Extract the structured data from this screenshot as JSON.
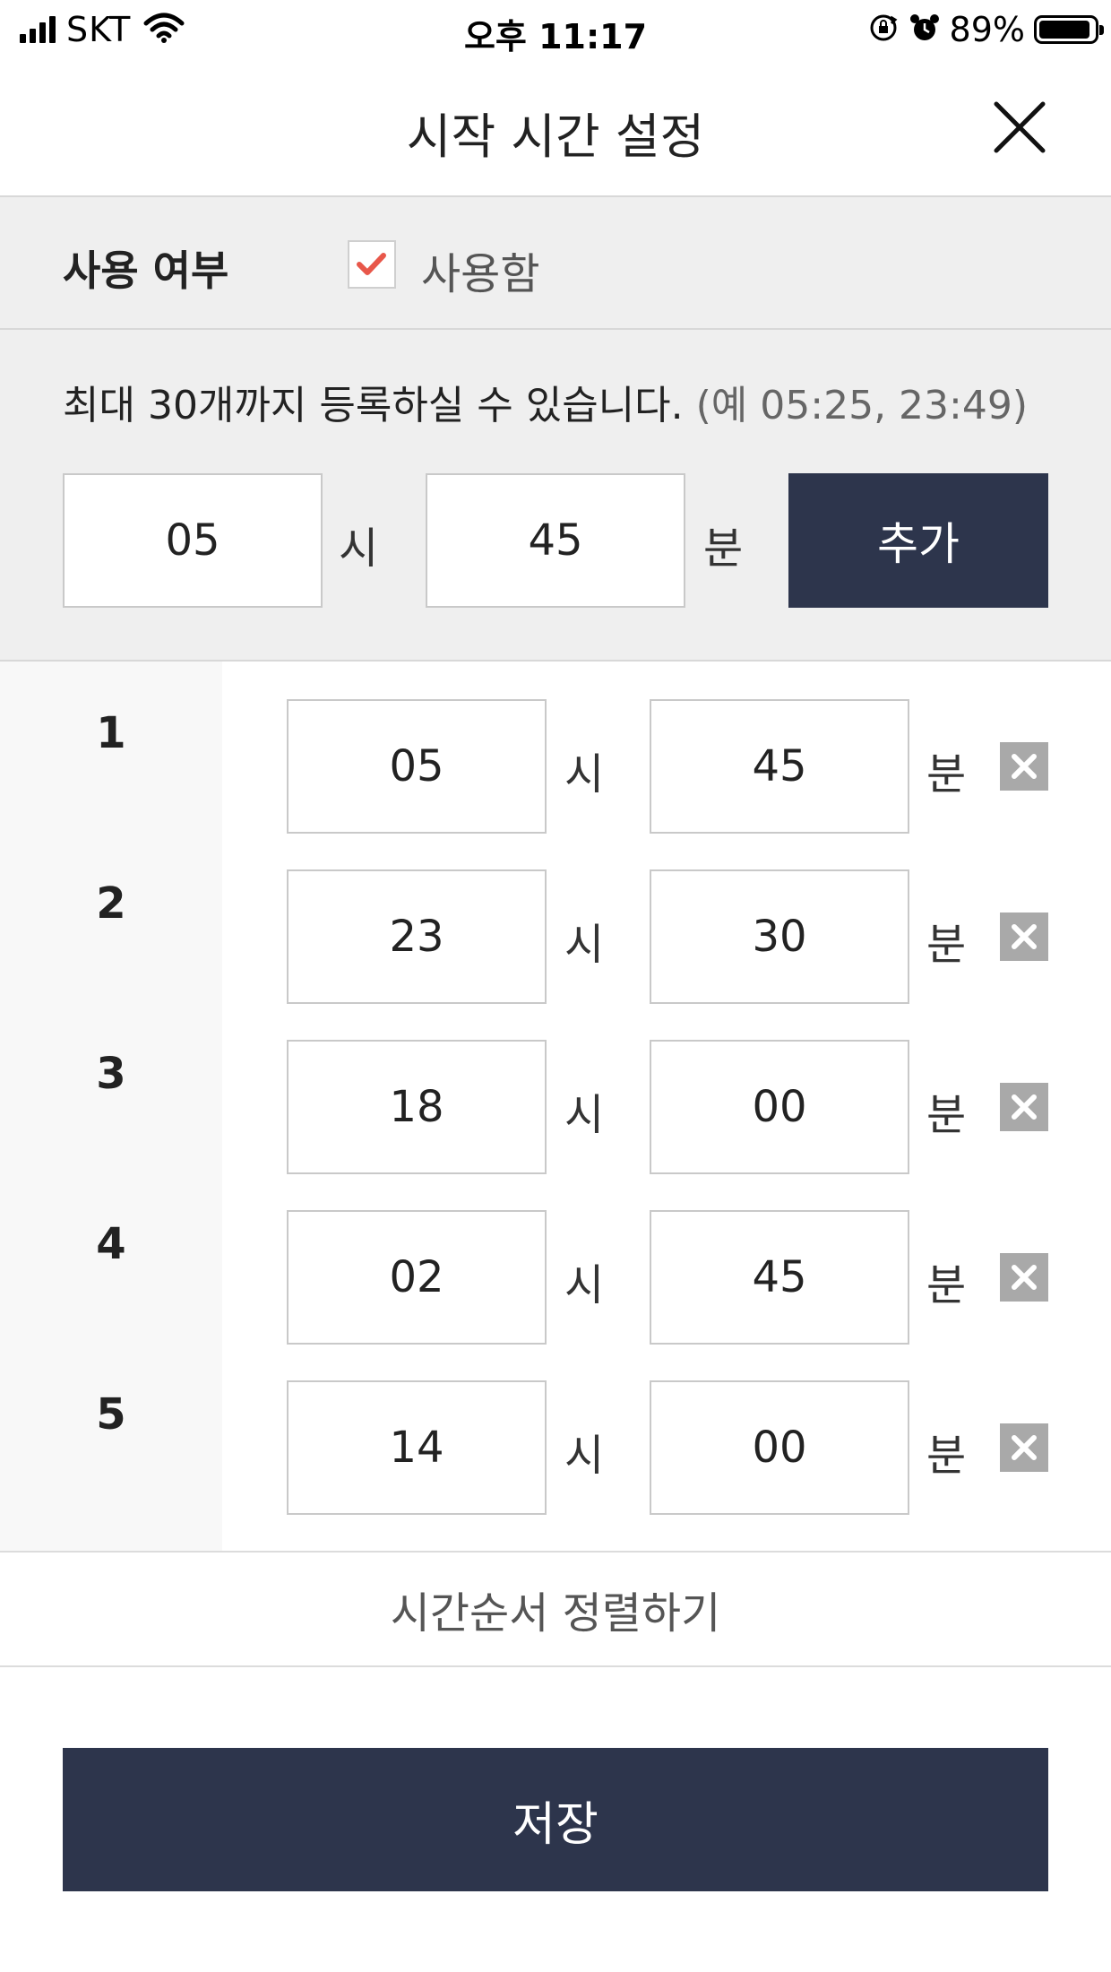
{
  "status_bar": {
    "carrier": "SKT",
    "time": "오후 11:17",
    "battery_percent": "89%",
    "icons": [
      "signal-icon",
      "wifi-icon",
      "rotation-lock-icon",
      "alarm-icon",
      "battery-icon"
    ]
  },
  "header": {
    "title": "시작 시간 설정",
    "close_icon": "close-icon"
  },
  "use_setting": {
    "label": "사용 여부",
    "checkbox_checked": true,
    "checkbox_text": "사용함",
    "check_color": "#e8574a"
  },
  "add_form": {
    "hint": "최대 30개까지 등록하실 수 있습니다.",
    "hint_example": "(예 05:25, 23:49)",
    "hour_value": "05",
    "hour_unit": "시",
    "minute_value": "45",
    "minute_unit": "분",
    "add_button": "추가"
  },
  "times": [
    {
      "index": "1",
      "hour": "05",
      "hour_unit": "시",
      "minute": "45",
      "minute_unit": "분"
    },
    {
      "index": "2",
      "hour": "23",
      "hour_unit": "시",
      "minute": "30",
      "minute_unit": "분"
    },
    {
      "index": "3",
      "hour": "18",
      "hour_unit": "시",
      "minute": "00",
      "minute_unit": "분"
    },
    {
      "index": "4",
      "hour": "02",
      "hour_unit": "시",
      "minute": "45",
      "minute_unit": "분"
    },
    {
      "index": "5",
      "hour": "14",
      "hour_unit": "시",
      "minute": "00",
      "minute_unit": "분"
    }
  ],
  "sort_button": "시간순서 정렬하기",
  "save_button": "저장",
  "colors": {
    "primary": "#2d354c",
    "band_bg": "#efefef",
    "delete_bg": "#a9a9a9"
  }
}
